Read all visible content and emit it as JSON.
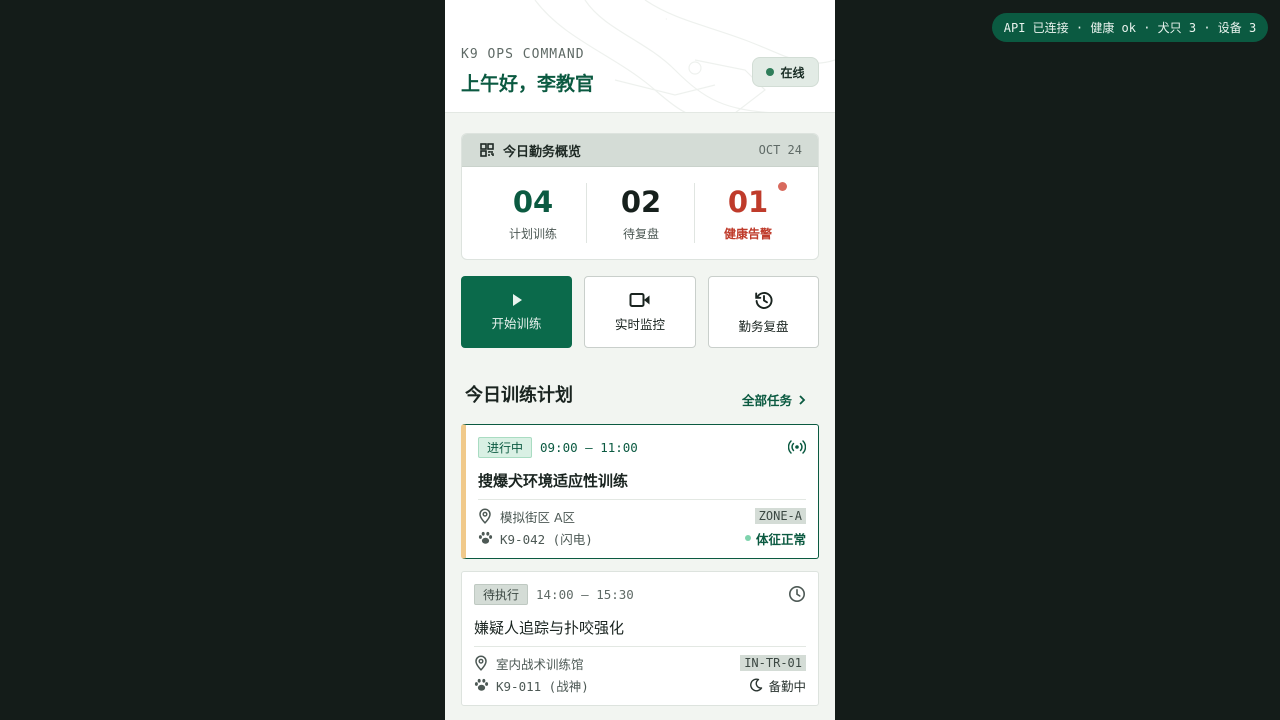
{
  "api_status": "API 已连接 · 健康 ok · 犬只 3 · 设备 3",
  "header": {
    "brand": "K9 OPS COMMAND",
    "greeting": "上午好，李教官",
    "online": "在线"
  },
  "summary": {
    "title": "今日勤务概览",
    "date": "OCT 24",
    "stats": [
      {
        "value": "04",
        "label": "计划训练"
      },
      {
        "value": "02",
        "label": "待复盘"
      },
      {
        "value": "01",
        "label": "健康告警"
      }
    ]
  },
  "actions": [
    {
      "label": "开始训练",
      "icon": "play-icon"
    },
    {
      "label": "实时监控",
      "icon": "video-camera-icon"
    },
    {
      "label": "勤务复盘",
      "icon": "history-icon"
    }
  ],
  "plan": {
    "title": "今日训练计划",
    "all_tasks": "全部任务",
    "tasks": [
      {
        "status": "进行中",
        "time": "09:00 – 11:00",
        "name": "搜爆犬环境适应性训练",
        "location": "模拟街区 A区",
        "zone": "ZONE-A",
        "dog": "K9-042 (闪电)",
        "condition": "体征正常",
        "status_icon": "broadcast-icon"
      },
      {
        "status": "待执行",
        "time": "14:00 – 15:30",
        "name": "嫌疑人追踪与扑咬强化",
        "location": "室内战术训练馆",
        "zone": "IN-TR-01",
        "dog": "K9-011 (战神)",
        "condition": "备勤中",
        "status_icon": "clock-icon"
      }
    ]
  },
  "colors": {
    "accent": "#0b5a41",
    "alert": "#bf3b2b",
    "background": "#141c19"
  }
}
